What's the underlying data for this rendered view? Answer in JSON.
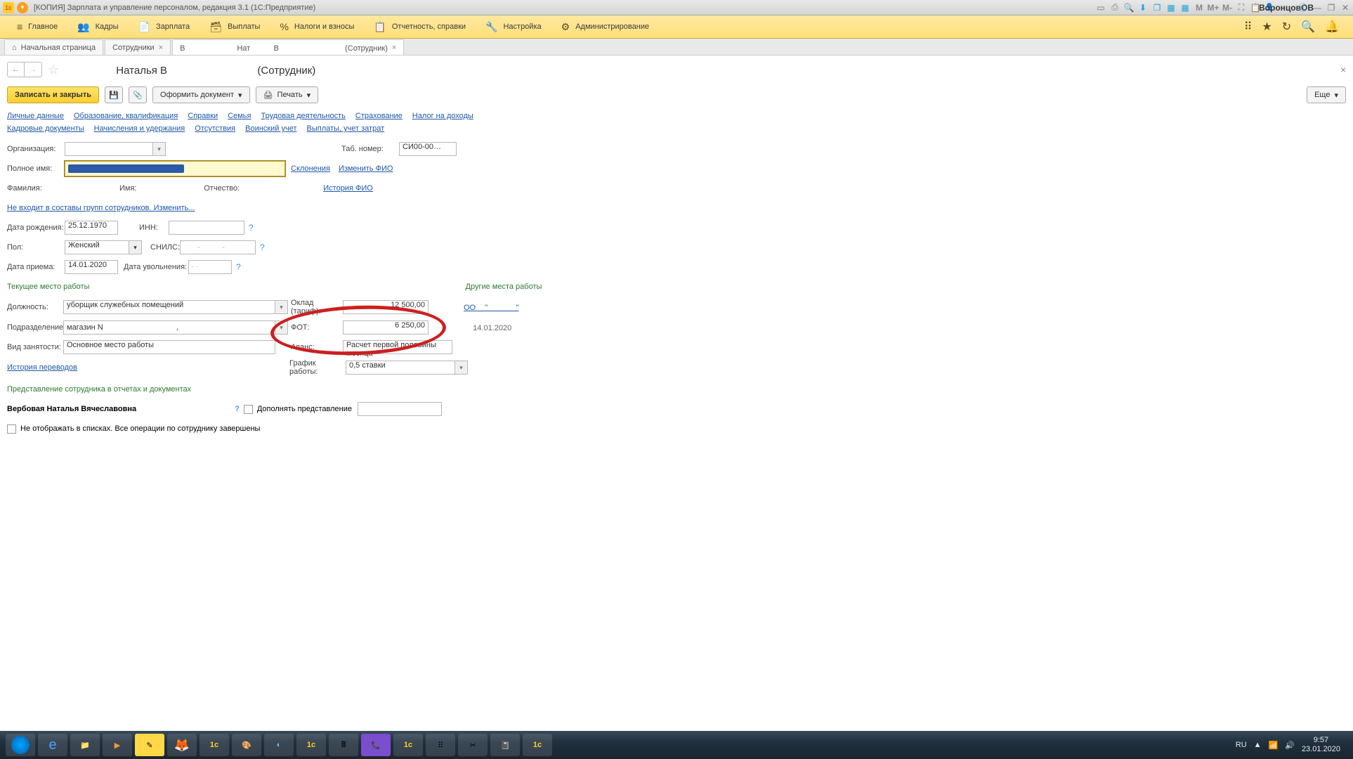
{
  "title": "[КОПИЯ] Зарплата и управление персоналом, редакция 3.1  (1С:Предприятие)",
  "user": "ВоронцовОВ",
  "menu": {
    "items": [
      {
        "icon": "≡",
        "label": "Главное"
      },
      {
        "icon": "👥",
        "label": "Кадры"
      },
      {
        "icon": "📄",
        "label": "Зарплата"
      },
      {
        "icon": "🗃",
        "label": "Выплаты"
      },
      {
        "icon": "%",
        "label": "Налоги и взносы"
      },
      {
        "icon": "📋",
        "label": "Отчетность, справки"
      },
      {
        "icon": "🔧",
        "label": "Настройка"
      },
      {
        "icon": "⚙",
        "label": "Администрирование"
      }
    ]
  },
  "tabs": [
    {
      "icon": "⌂",
      "label": "Начальная страница",
      "close": false
    },
    {
      "icon": "",
      "label": "Сотрудники",
      "close": true
    },
    {
      "icon": "",
      "label": "Вᅠᅠᅠᅠᅠᅠᅠ Натᅠᅠᅠ Вᅠᅠᅠᅠᅠᅠᅠᅠᅠ (Сотрудник)",
      "close": true,
      "active": true
    }
  ],
  "page": {
    "title": "ᅠᅠᅠᅠᅠ Наталья Вᅠᅠᅠᅠᅠᅠᅠᅠᅠ (Сотрудник)"
  },
  "actions": {
    "save": "Записать и закрыть",
    "doc": "Оформить документ",
    "print": "Печать",
    "more": "Еще"
  },
  "subtabs1": [
    "Личные данные",
    "Образование, квалификация",
    "Справки",
    "Семья",
    "Трудовая деятельность",
    "Страхование",
    "Налог на доходы"
  ],
  "subtabs2": [
    "Кадровые документы",
    "Начисления и удержания",
    "Отсутствия",
    "Воинский учет",
    "Выплаты, учет затрат"
  ],
  "labels": {
    "org": "Организация:",
    "tab": "Таб. номер:",
    "fullname": "Полное имя:",
    "declension": "Склонения",
    "edit_fio": "Изменить ФИО",
    "fam": "Фамилия:",
    "name": "Имя:",
    "patr": "Отчество:",
    "history_fio": "История ФИО",
    "group_link": "Не входит в составы групп сотрудников. Изменить...",
    "dob": "Дата рождения:",
    "inn": "ИНН:",
    "sex": "Пол:",
    "snils": "СНИЛС:",
    "hire": "Дата приема:",
    "fire": "Дата увольнения:",
    "current_head": "Текущее место работы",
    "other_head": "Другие места работы",
    "position": "Должность:",
    "salary": "Оклад (тариф):",
    "dept": "Подразделение:",
    "fot": "ФОТ:",
    "employment": "Вид занятости:",
    "advance": "Аванс:",
    "schedule": "График работы:",
    "history_trans": "История переводов",
    "repr_head": "Представление сотрудника в отчетах и документах",
    "repr_name": "Вербовая Наталья Вячеславовна",
    "add_repr": "Дополнять представление",
    "hide": "Не отображать в списках. Все операции по сотруднику завершены",
    "ooo_link": "ООᅠ \"ᅠᅠᅠᅠ\"",
    "ooo_sub": "ᅠ 14.01.2020"
  },
  "values": {
    "org": "ᅠᅠᅠᅠᅠ",
    "tab": "СИ00-00…",
    "name_initial": "ᅠᅠ",
    "dob": "25.12.1970",
    "inn": "ᅠᅠᅠᅠᅠᅠᅠᅠ",
    "sex": "Женский",
    "snils": "ᅠᅠ-ᅠᅠᅠ-ᅠᅠᅠ ᅠᅠ",
    "hire": "14.01.2020",
    "fire": "  .  .",
    "position": "уборщик служебных помещений",
    "salary": "12 500,00",
    "dept": "магазин N ᅠᅠᅠᅠᅠᅠᅠᅠᅠᅠ,",
    "fot": "6 250,00",
    "employment": "Основное место работы",
    "advance": "Расчет первой половины месяца",
    "schedule": "0,5 ставки"
  },
  "sys": {
    "lang": "RU",
    "time": "9:57",
    "date": "23.01.2020"
  }
}
